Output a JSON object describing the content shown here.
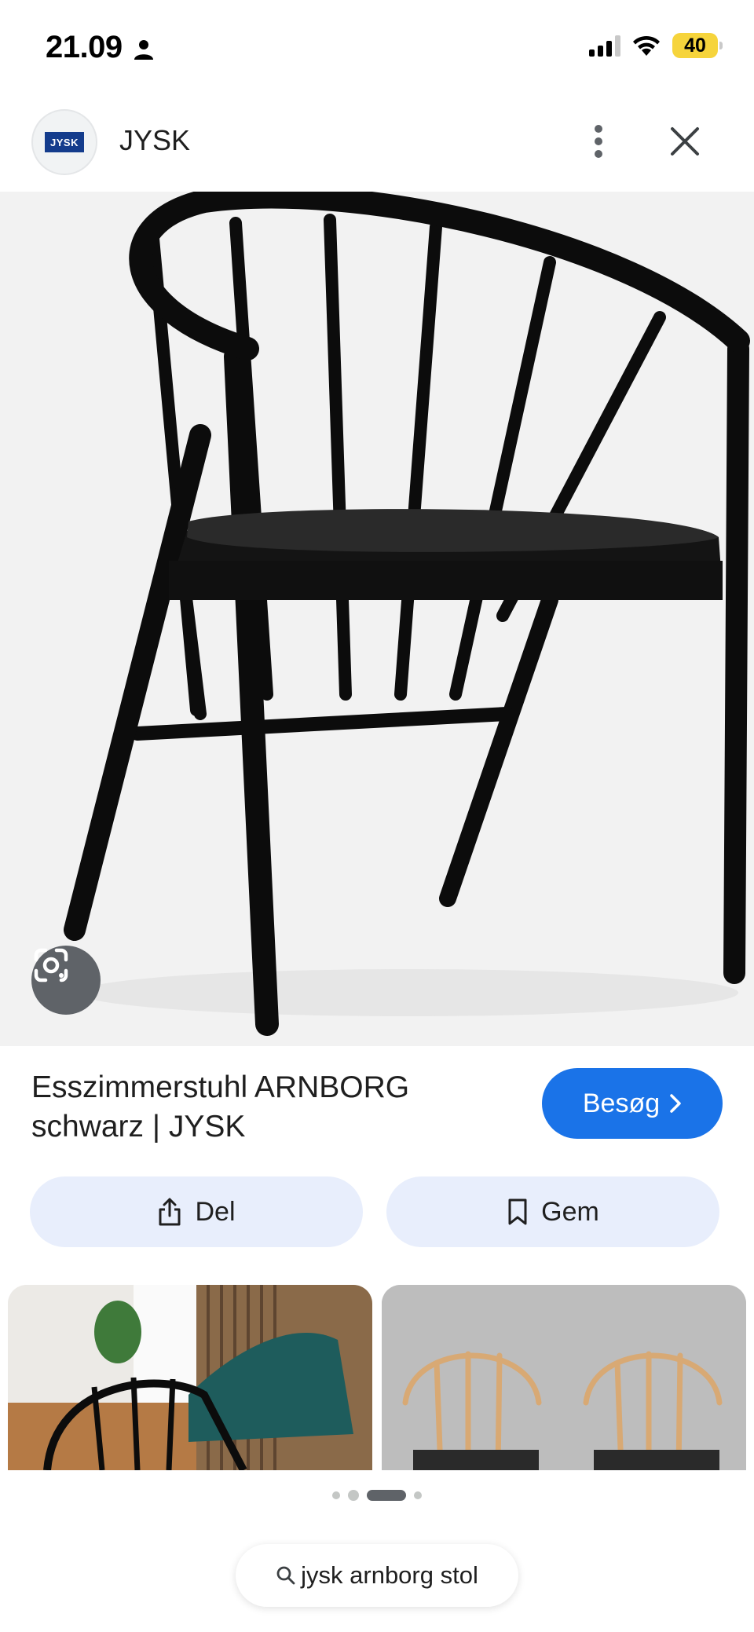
{
  "status_bar": {
    "time": "21.09",
    "battery": "40",
    "icons": [
      "person-icon",
      "cellular-signal-icon",
      "wifi-icon",
      "battery-icon"
    ]
  },
  "header": {
    "site_name": "JYSK",
    "logo_text": "JYSK",
    "icons": [
      "more-vertical-icon",
      "close-icon"
    ]
  },
  "main_image": {
    "icon": "google-lens-icon"
  },
  "result": {
    "title_line1": "Esszimmerstuhl ARNBORG",
    "title_line2": "schwarz | JYSK",
    "visit_label": "Besøg",
    "visit_icon": "chevron-right-icon"
  },
  "actions": {
    "share_label": "Del",
    "share_icon": "share-icon",
    "save_label": "Gem",
    "save_icon": "bookmark-icon"
  },
  "pager": {
    "count": 4,
    "active_index": 2
  },
  "search": {
    "query": "jysk arnborg stol",
    "icon": "search-icon"
  },
  "colors": {
    "accent": "#1a73e8",
    "action_bg": "#e8eefc",
    "image_bg": "#f2f2f2",
    "lens_bg": "#5f6368",
    "battery": "#f6d43c"
  }
}
